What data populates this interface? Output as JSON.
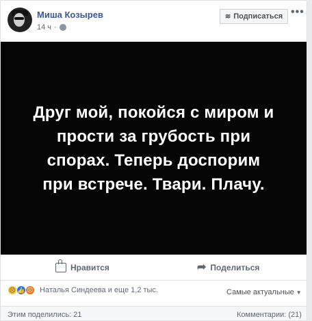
{
  "post": {
    "author": "Миша Козырев",
    "time": "14 ч",
    "subscribe_label": "Подписаться",
    "more_label": "•••",
    "image_text": "Друг мой, покойся с миром и прости за грубость при спорах. Теперь доспорим при встрече. Твари. Плачу.",
    "icons": {
      "globe": "globe-icon",
      "rss": "rss-icon",
      "like": "thumbs-up-icon",
      "share": "share-arrow-icon"
    }
  },
  "actions": {
    "like_label": "Нравится",
    "share_label": "Поделиться"
  },
  "reactions": {
    "summary": "Наталья Синдеева и еще 1,2 тыс.",
    "types": [
      "sad-reaction-icon",
      "like-reaction-icon",
      "angry-reaction-icon"
    ],
    "sort_label": "Самые актуальные"
  },
  "footer": {
    "shared": "Этим поделились: 21",
    "comments": "Комментарии: (21)"
  },
  "colors": {
    "link": "#385898",
    "meta": "#616770",
    "image_bg": "#050505",
    "image_text": "#ffffff"
  }
}
